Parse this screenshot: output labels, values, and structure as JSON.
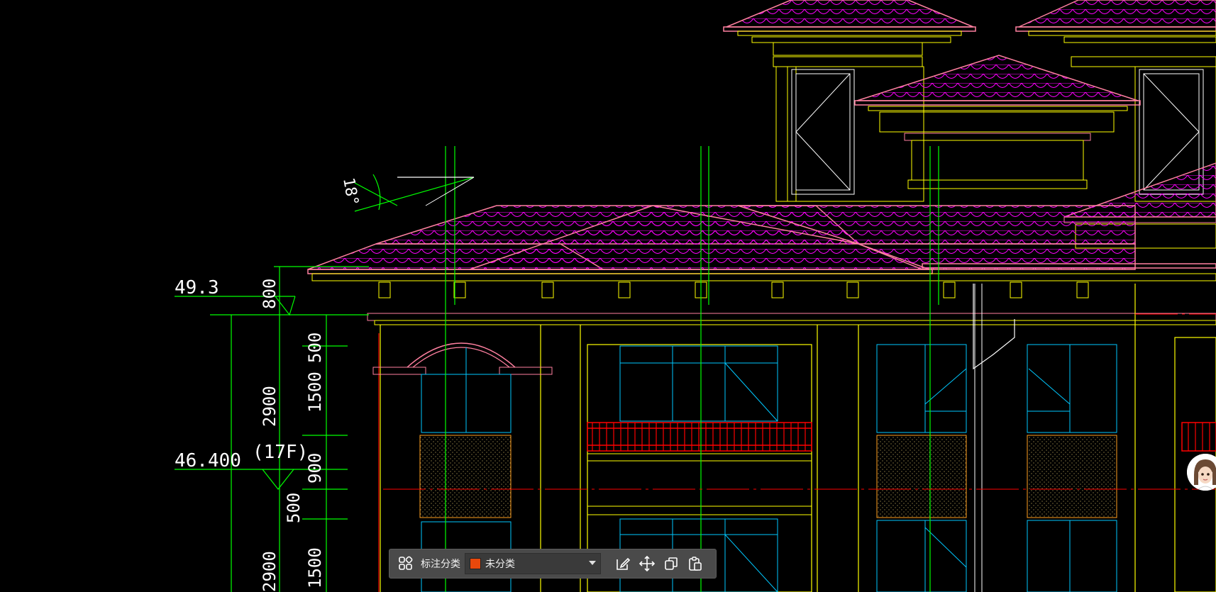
{
  "drawing": {
    "elevation_top": "49.3",
    "elevation_floor": "46.400",
    "floor_label": "(17F)",
    "angle_label": "18°",
    "dims_col1": [
      "800",
      "2900",
      "500",
      "2900"
    ],
    "dims_col2": [
      "500",
      "1500",
      "900",
      "500",
      "1500"
    ]
  },
  "toolbar": {
    "category_label": "标注分类",
    "select_value": "未分类",
    "select_color": "#e8480c"
  },
  "colors": {
    "background": "#000000",
    "roof": "#ff00ff",
    "outline": "#ffff00",
    "window": "#00c8ff",
    "axis": "#00ff00",
    "dimension": "#ffffff",
    "railing": "#ff0000",
    "eave": "#ff80a0"
  },
  "icons": {
    "category": "category-grid-icon",
    "edit": "edit-icon",
    "move": "move-icon",
    "copy": "copy-icon",
    "paste": "paste-icon",
    "assistant": "assistant-avatar-icon"
  }
}
